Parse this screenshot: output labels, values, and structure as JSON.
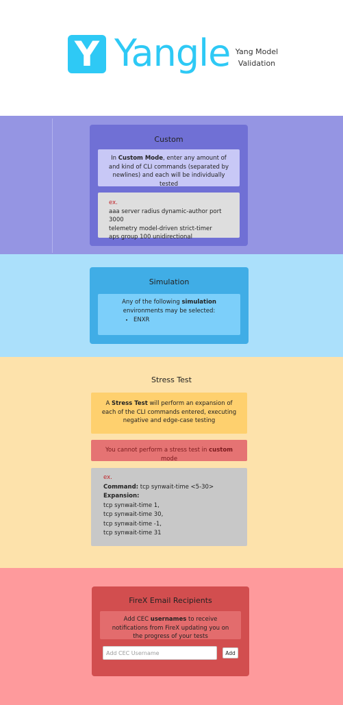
{
  "header": {
    "logo_letter": "Y",
    "logo_word": "Yangle",
    "tagline_line1": "Yang Model",
    "tagline_line2": "Validation"
  },
  "custom": {
    "title": "Custom",
    "desc_pre": "In ",
    "desc_bold": "Custom Mode",
    "desc_post": ", enter any amount of and kind of CLI commands (separated by newlines) and each will be individually tested",
    "example_label": "ex.",
    "example_lines": [
      "aaa server radius dynamic-author port 3000",
      "telemetry model-driven strict-timer",
      "aps group 100 unidirectional"
    ]
  },
  "simulation": {
    "title": "Simulation",
    "desc_pre": "Any of the following ",
    "desc_bold": "simulation",
    "desc_post": " environments may be selected:",
    "environments": [
      "ENXR"
    ]
  },
  "stress": {
    "title": "Stress Test",
    "desc_pre": "A ",
    "desc_bold": "Stress Test",
    "desc_post": " will perform an expansion of each of the CLI commands entered, executing negative and edge-case testing",
    "warning_pre": "You cannot perform a stress test in ",
    "warning_bold": "custom",
    "warning_post": " mode",
    "example_label": "ex.",
    "command_label": "Command:",
    "command_value": " tcp synwait-time <5-30>",
    "expansion_label": "Expansion:",
    "expansion_lines": [
      "tcp synwait-time 1,",
      "tcp synwait-time 30,",
      "tcp synwait-time -1,",
      "tcp synwait-time 31"
    ]
  },
  "firex": {
    "title": "FireX Email Recipients",
    "desc_pre": "Add CEC ",
    "desc_bold": "usernames",
    "desc_post": " to receive notifications from FireX updating you on the progress of your tests",
    "input_placeholder": "Add CEC Username",
    "input_value": "",
    "add_label": "Add"
  },
  "colors": {
    "brand": "#2ec9f5",
    "custom_bg": "#9595e3",
    "custom_card": "#7070d5",
    "sim_bg": "#abe0fb",
    "sim_card": "#40ade6",
    "stress_bg": "#fde2ab",
    "stress_desc": "#fed06e",
    "stress_warn": "#e57373",
    "firex_bg": "#fe9a9c",
    "firex_card": "#d24e4f",
    "example_red": "#c0252a"
  }
}
